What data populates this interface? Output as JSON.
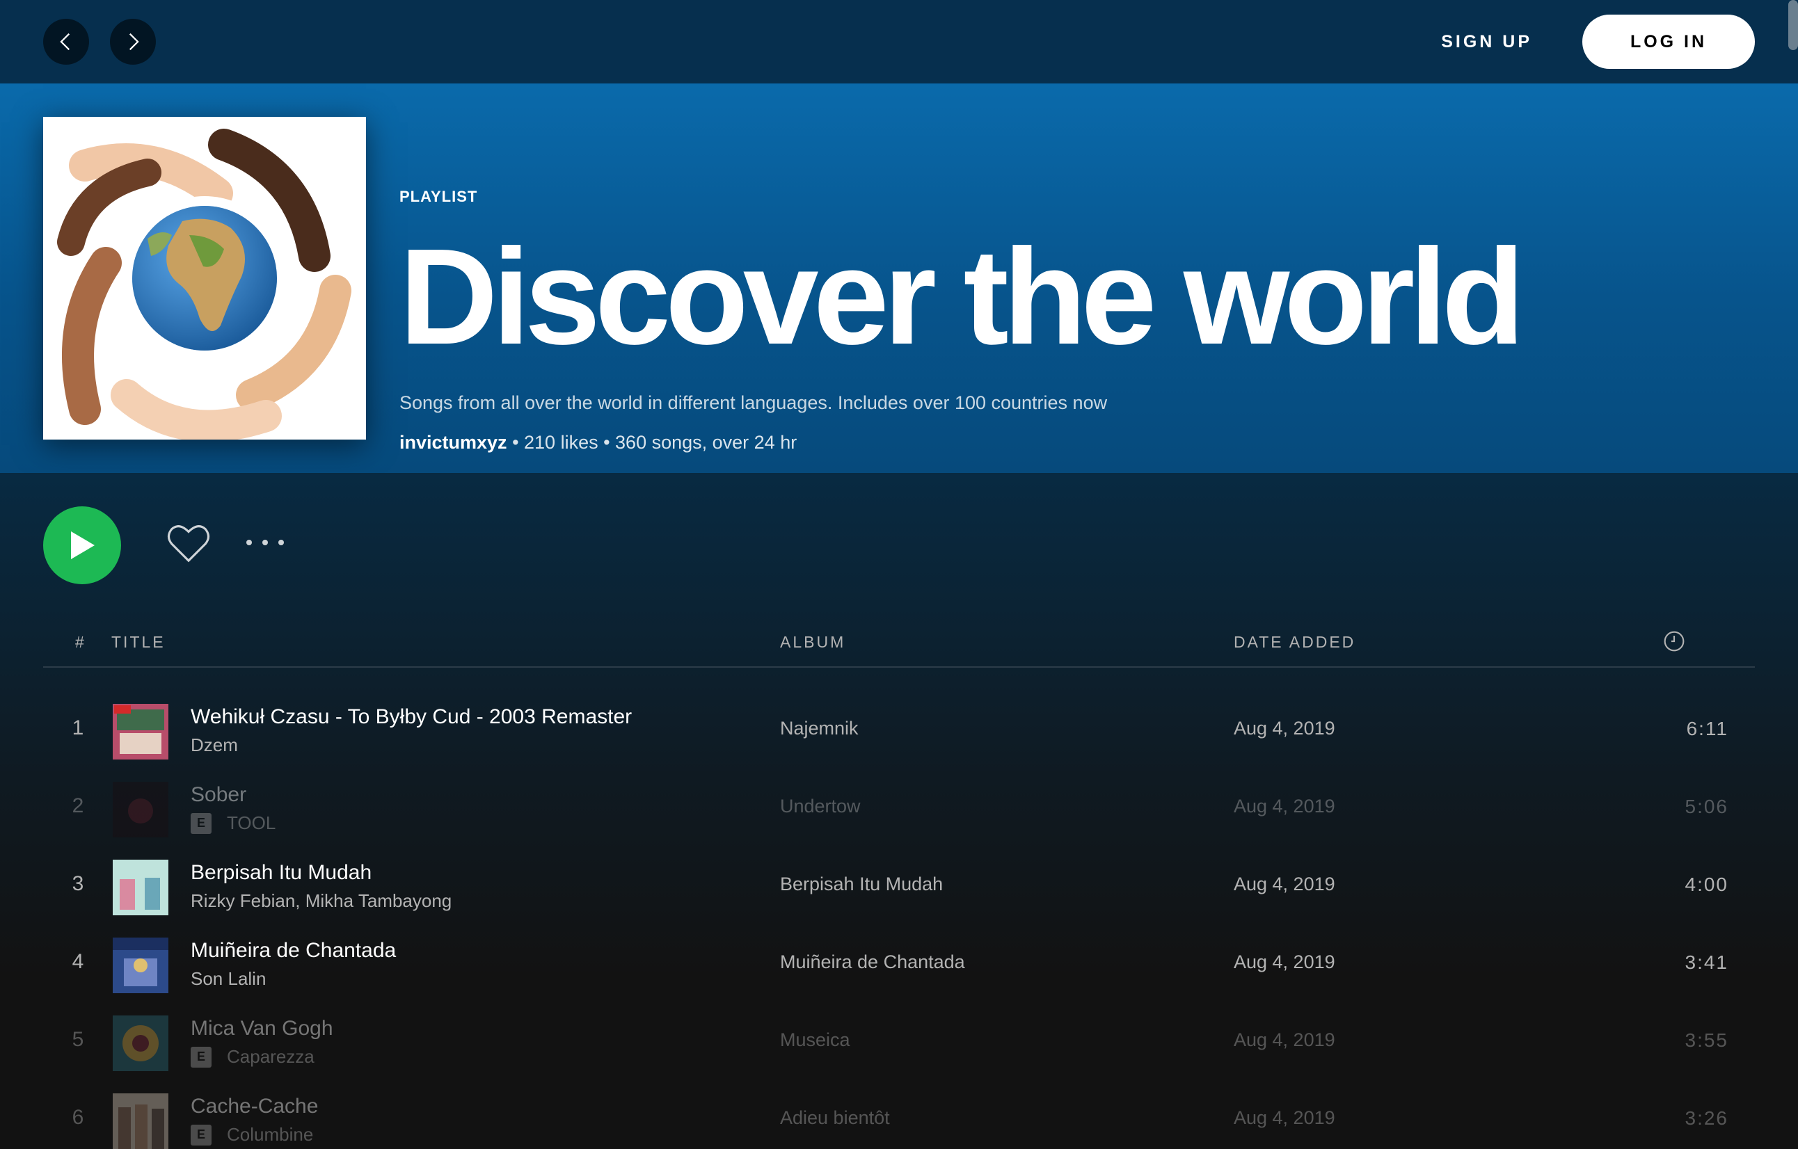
{
  "topbar": {
    "back_icon": "chevron-left-icon",
    "forward_icon": "chevron-right-icon",
    "signup_label": "SIGN UP",
    "login_label": "LOG IN"
  },
  "playlist": {
    "type_label": "PLAYLIST",
    "title": "Discover the world",
    "description": "Songs from all over the world in different languages. Includes over 100 countries now",
    "owner": "invictumxyz",
    "meta": " • 210 likes • 360 songs, over 24 hr"
  },
  "actions": {
    "play_icon": "play-icon",
    "like_icon": "heart-icon",
    "more_icon": "more-options-icon",
    "play_color": "#1db954"
  },
  "table": {
    "headers": {
      "number": "#",
      "title": "TITLE",
      "album": "ALBUM",
      "date_added": "DATE ADDED",
      "duration_icon": "clock-icon"
    },
    "rows": [
      {
        "number": "1",
        "title": "Wehikuł Czasu - To Byłby Cud - 2003 Remaster",
        "artist": "Dzem",
        "explicit": false,
        "album": "Najemnik",
        "date_added": "Aug 4, 2019",
        "duration": "6:11",
        "playable": true
      },
      {
        "number": "2",
        "title": "Sober",
        "artist": "TOOL",
        "explicit": true,
        "explicit_label": "E",
        "album": "Undertow",
        "date_added": "Aug 4, 2019",
        "duration": "5:06",
        "playable": false
      },
      {
        "number": "3",
        "title": "Berpisah Itu Mudah",
        "artist": "Rizky Febian, Mikha Tambayong",
        "explicit": false,
        "album": "Berpisah Itu Mudah",
        "date_added": "Aug 4, 2019",
        "duration": "4:00",
        "playable": true
      },
      {
        "number": "4",
        "title": "Muiñeira de Chantada",
        "artist": "Son Lalin",
        "explicit": false,
        "album": "Muiñeira de Chantada",
        "date_added": "Aug 4, 2019",
        "duration": "3:41",
        "playable": true
      },
      {
        "number": "5",
        "title": "Mica Van Gogh",
        "artist": "Caparezza",
        "explicit": true,
        "explicit_label": "E",
        "album": "Museica",
        "date_added": "Aug 4, 2019",
        "duration": "3:55",
        "playable": false
      },
      {
        "number": "6",
        "title": "Cache-Cache",
        "artist": "Columbine",
        "explicit": true,
        "explicit_label": "E",
        "album": "Adieu bientôt",
        "date_added": "Aug 4, 2019",
        "duration": "3:26",
        "playable": false
      }
    ]
  }
}
